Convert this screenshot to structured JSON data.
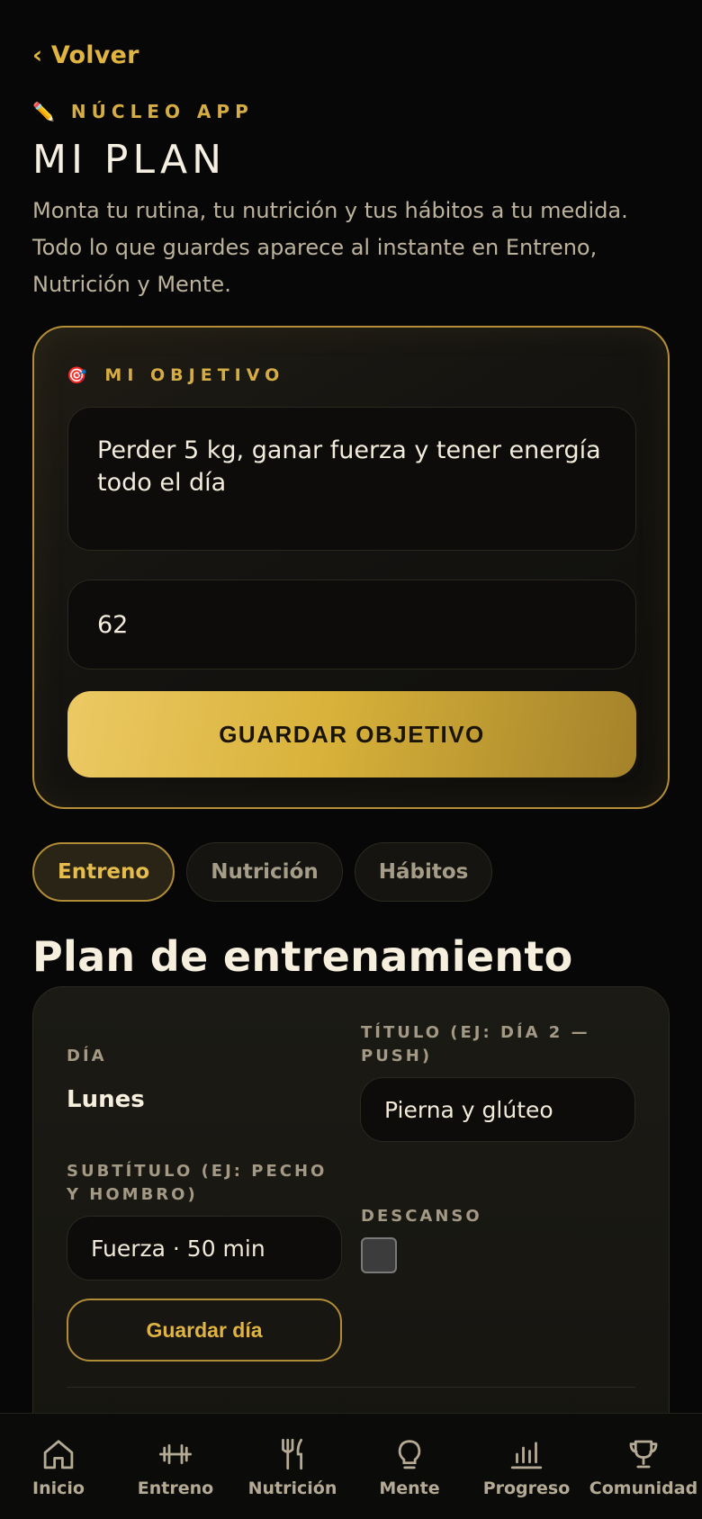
{
  "header": {
    "back_label": "‹ Volver",
    "eyebrow_icon": "✏️",
    "eyebrow": "NÚCLEO APP",
    "title": "MI PLAN",
    "lead": "Monta tu rutina, tu nutrición y tus hábitos a tu medida. Todo lo que guardes aparece al instante en Entreno, Nutrición y Mente."
  },
  "objective": {
    "label_icon": "🎯",
    "label": "MI OBJETIVO",
    "goal_text": "Perder 5 kg, ganar fuerza y tener energía todo el día",
    "weight_value": "62",
    "save_label": "GUARDAR OBJETIVO"
  },
  "tabs": [
    {
      "label": "Entreno",
      "active": true
    },
    {
      "label": "Nutrición",
      "active": false
    },
    {
      "label": "Hábitos",
      "active": false
    }
  ],
  "plan": {
    "section_title": "Plan de entrenamiento",
    "day_label": "DÍA",
    "day_value": "Lunes",
    "title_label": "TÍTULO (EJ: DÍA 2 — PUSH)",
    "title_value": "Pierna y glúteo",
    "subtitle_label": "SUBTÍTULO (EJ: PECHO Y HOMBRO)",
    "subtitle_value": "Fuerza · 50 min",
    "rest_label": "DESCANSO",
    "save_day_label": "Guardar día"
  },
  "nav": [
    {
      "label": "Inicio",
      "icon": "home-icon"
    },
    {
      "label": "Entreno",
      "icon": "dumbbell-icon"
    },
    {
      "label": "Nutrición",
      "icon": "fork-knife-icon"
    },
    {
      "label": "Mente",
      "icon": "lightbulb-icon"
    },
    {
      "label": "Progreso",
      "icon": "bar-chart-icon"
    },
    {
      "label": "Comunidad",
      "icon": "trophy-icon"
    }
  ],
  "colors": {
    "accent_gold": "#e0b440",
    "background": "#070707",
    "card_border": "#b58f38"
  }
}
